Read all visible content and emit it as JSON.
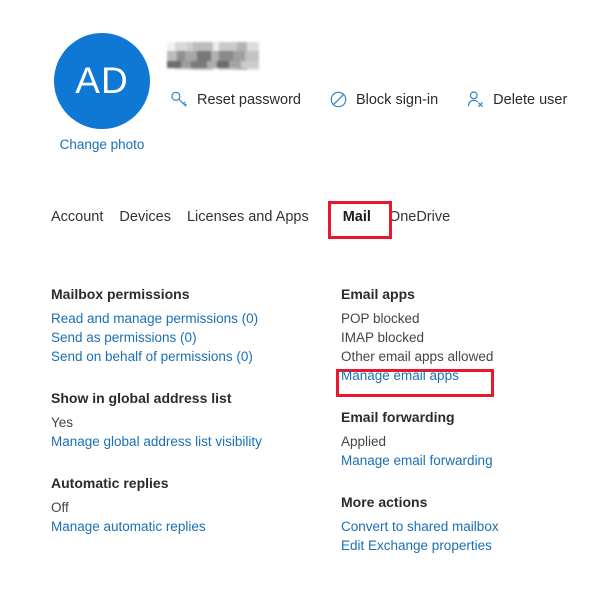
{
  "header": {
    "avatar_initials": "AD",
    "avatar_color": "#0f78d4",
    "change_photo_label": "Change photo",
    "user_name_redacted": true,
    "actions": [
      {
        "label": "Reset password",
        "icon": "key-icon"
      },
      {
        "label": "Block sign-in",
        "icon": "block-icon"
      },
      {
        "label": "Delete user",
        "icon": "person-delete-icon"
      }
    ]
  },
  "tabs": [
    {
      "label": "Account",
      "selected": false
    },
    {
      "label": "Devices",
      "selected": false
    },
    {
      "label": "Licenses and Apps",
      "selected": false
    },
    {
      "label": "Mail",
      "selected": true
    },
    {
      "label": "OneDrive",
      "selected": false
    }
  ],
  "annotations": {
    "color": "#e8192c",
    "boxes": [
      {
        "target": "Mail"
      },
      {
        "target": "Manage email apps"
      }
    ]
  },
  "details": {
    "left_column": [
      {
        "title": "Mailbox permissions",
        "values": [],
        "links": [
          "Read and manage permissions (0)",
          "Send as permissions (0)",
          "Send on behalf of permissions (0)"
        ]
      },
      {
        "title": "Show in global address list",
        "values": [
          "Yes"
        ],
        "links": [
          "Manage global address list visibility"
        ]
      },
      {
        "title": "Automatic replies",
        "values": [
          "Off"
        ],
        "links": [
          "Manage automatic replies"
        ]
      }
    ],
    "right_column": [
      {
        "title": "Email apps",
        "values": [
          "POP blocked",
          "IMAP blocked",
          "Other email apps allowed"
        ],
        "links": [
          "Manage email apps"
        ]
      },
      {
        "title": "Email forwarding",
        "values": [
          "Applied"
        ],
        "links": [
          "Manage email forwarding"
        ]
      },
      {
        "title": "More actions",
        "values": [],
        "links": [
          "Convert to shared mailbox",
          "Edit Exchange properties"
        ]
      }
    ]
  },
  "colors": {
    "link": "#1a6fb5",
    "text": "#333333",
    "accent": "#0f78d4",
    "annotation": "#e8192c"
  }
}
